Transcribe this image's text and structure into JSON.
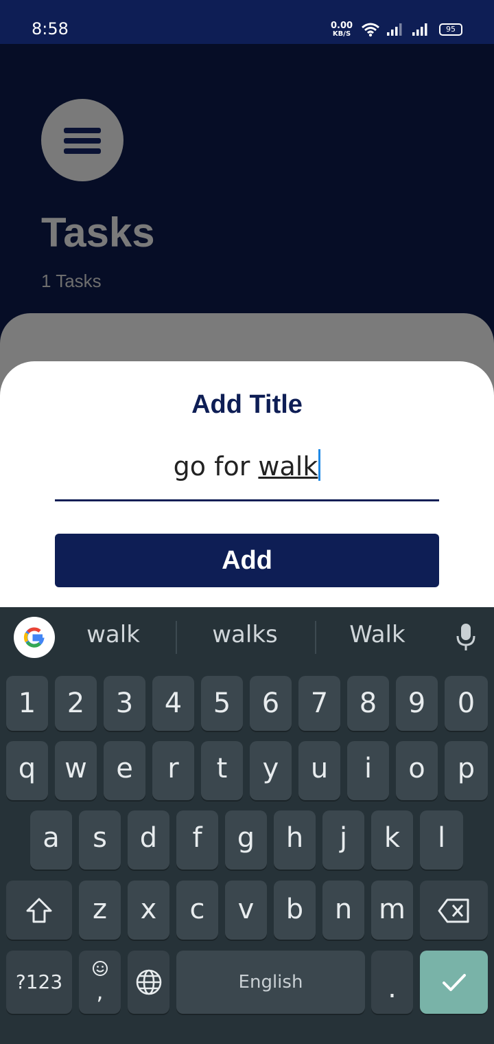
{
  "status_bar": {
    "time": "8:58",
    "net_speed": "0.00",
    "net_unit": "KB/S",
    "battery": "95"
  },
  "app": {
    "title": "Tasks",
    "subtitle": "1 Tasks"
  },
  "sheet": {
    "title": "Add Title",
    "input_prefix": "go for ",
    "input_composing": "walk",
    "add_label": "Add"
  },
  "keyboard": {
    "suggestions": [
      "walk",
      "walks",
      "Walk"
    ],
    "row_numbers": [
      "1",
      "2",
      "3",
      "4",
      "5",
      "6",
      "7",
      "8",
      "9",
      "0"
    ],
    "row_top": [
      "q",
      "w",
      "e",
      "r",
      "t",
      "y",
      "u",
      "i",
      "o",
      "p"
    ],
    "row_middle": [
      "a",
      "s",
      "d",
      "f",
      "g",
      "h",
      "j",
      "k",
      "l"
    ],
    "row_bottom": [
      "z",
      "x",
      "c",
      "v",
      "b",
      "n",
      "m"
    ],
    "symbols_label": "?123",
    "comma_label": ",",
    "space_label": "English",
    "period_label": "."
  },
  "colors": {
    "primary": "#0e1e55",
    "cursor": "#1e88e5",
    "enter_key": "#79b3a8"
  }
}
